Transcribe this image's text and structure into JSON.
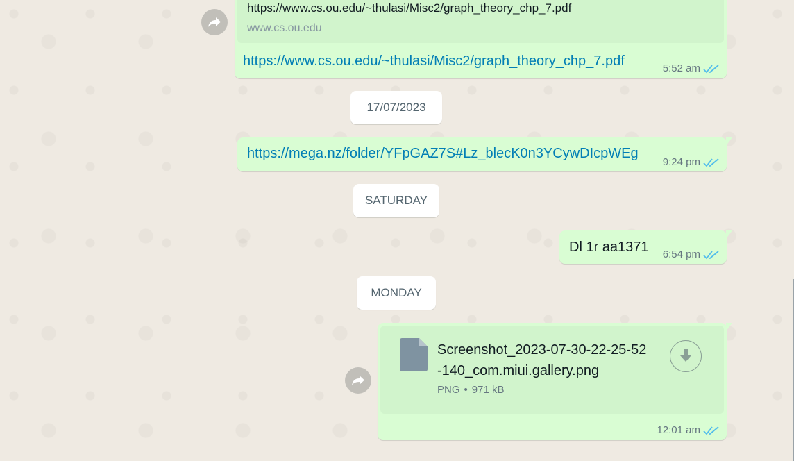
{
  "messages": {
    "m1": {
      "preview_title": "https://www.cs.ou.edu/~thulasi/Misc2/graph_theory_chp_7.pdf",
      "preview_domain": "www.cs.ou.edu",
      "link": "https://www.cs.ou.edu/~thulasi/Misc2/graph_theory_chp_7.pdf",
      "time": "5:52 am"
    },
    "date1": "17/07/2023",
    "m2": {
      "link": "https://mega.nz/folder/YFpGAZ7S#Lz_blecK0n3YCywDIcpWEg",
      "time": "9:24 pm"
    },
    "date2": "SATURDAY",
    "m3": {
      "text": "Dl 1r aa1371",
      "time": "6:54 pm"
    },
    "date3": "MONDAY",
    "m4": {
      "file_name_line1": "Screenshot_2023-07-30-22-25-52",
      "file_name_line2": "-140_com.miui.gallery.png",
      "file_type": "PNG",
      "file_size": "971 kB",
      "time": "12:01 am"
    }
  },
  "colors": {
    "bubble": "#d9fdd3",
    "link": "#027eb5",
    "tick_read": "#53bdeb",
    "background": "#efeae2"
  },
  "icons": [
    "forward-icon",
    "double-tick-icon",
    "document-icon",
    "download-icon"
  ]
}
